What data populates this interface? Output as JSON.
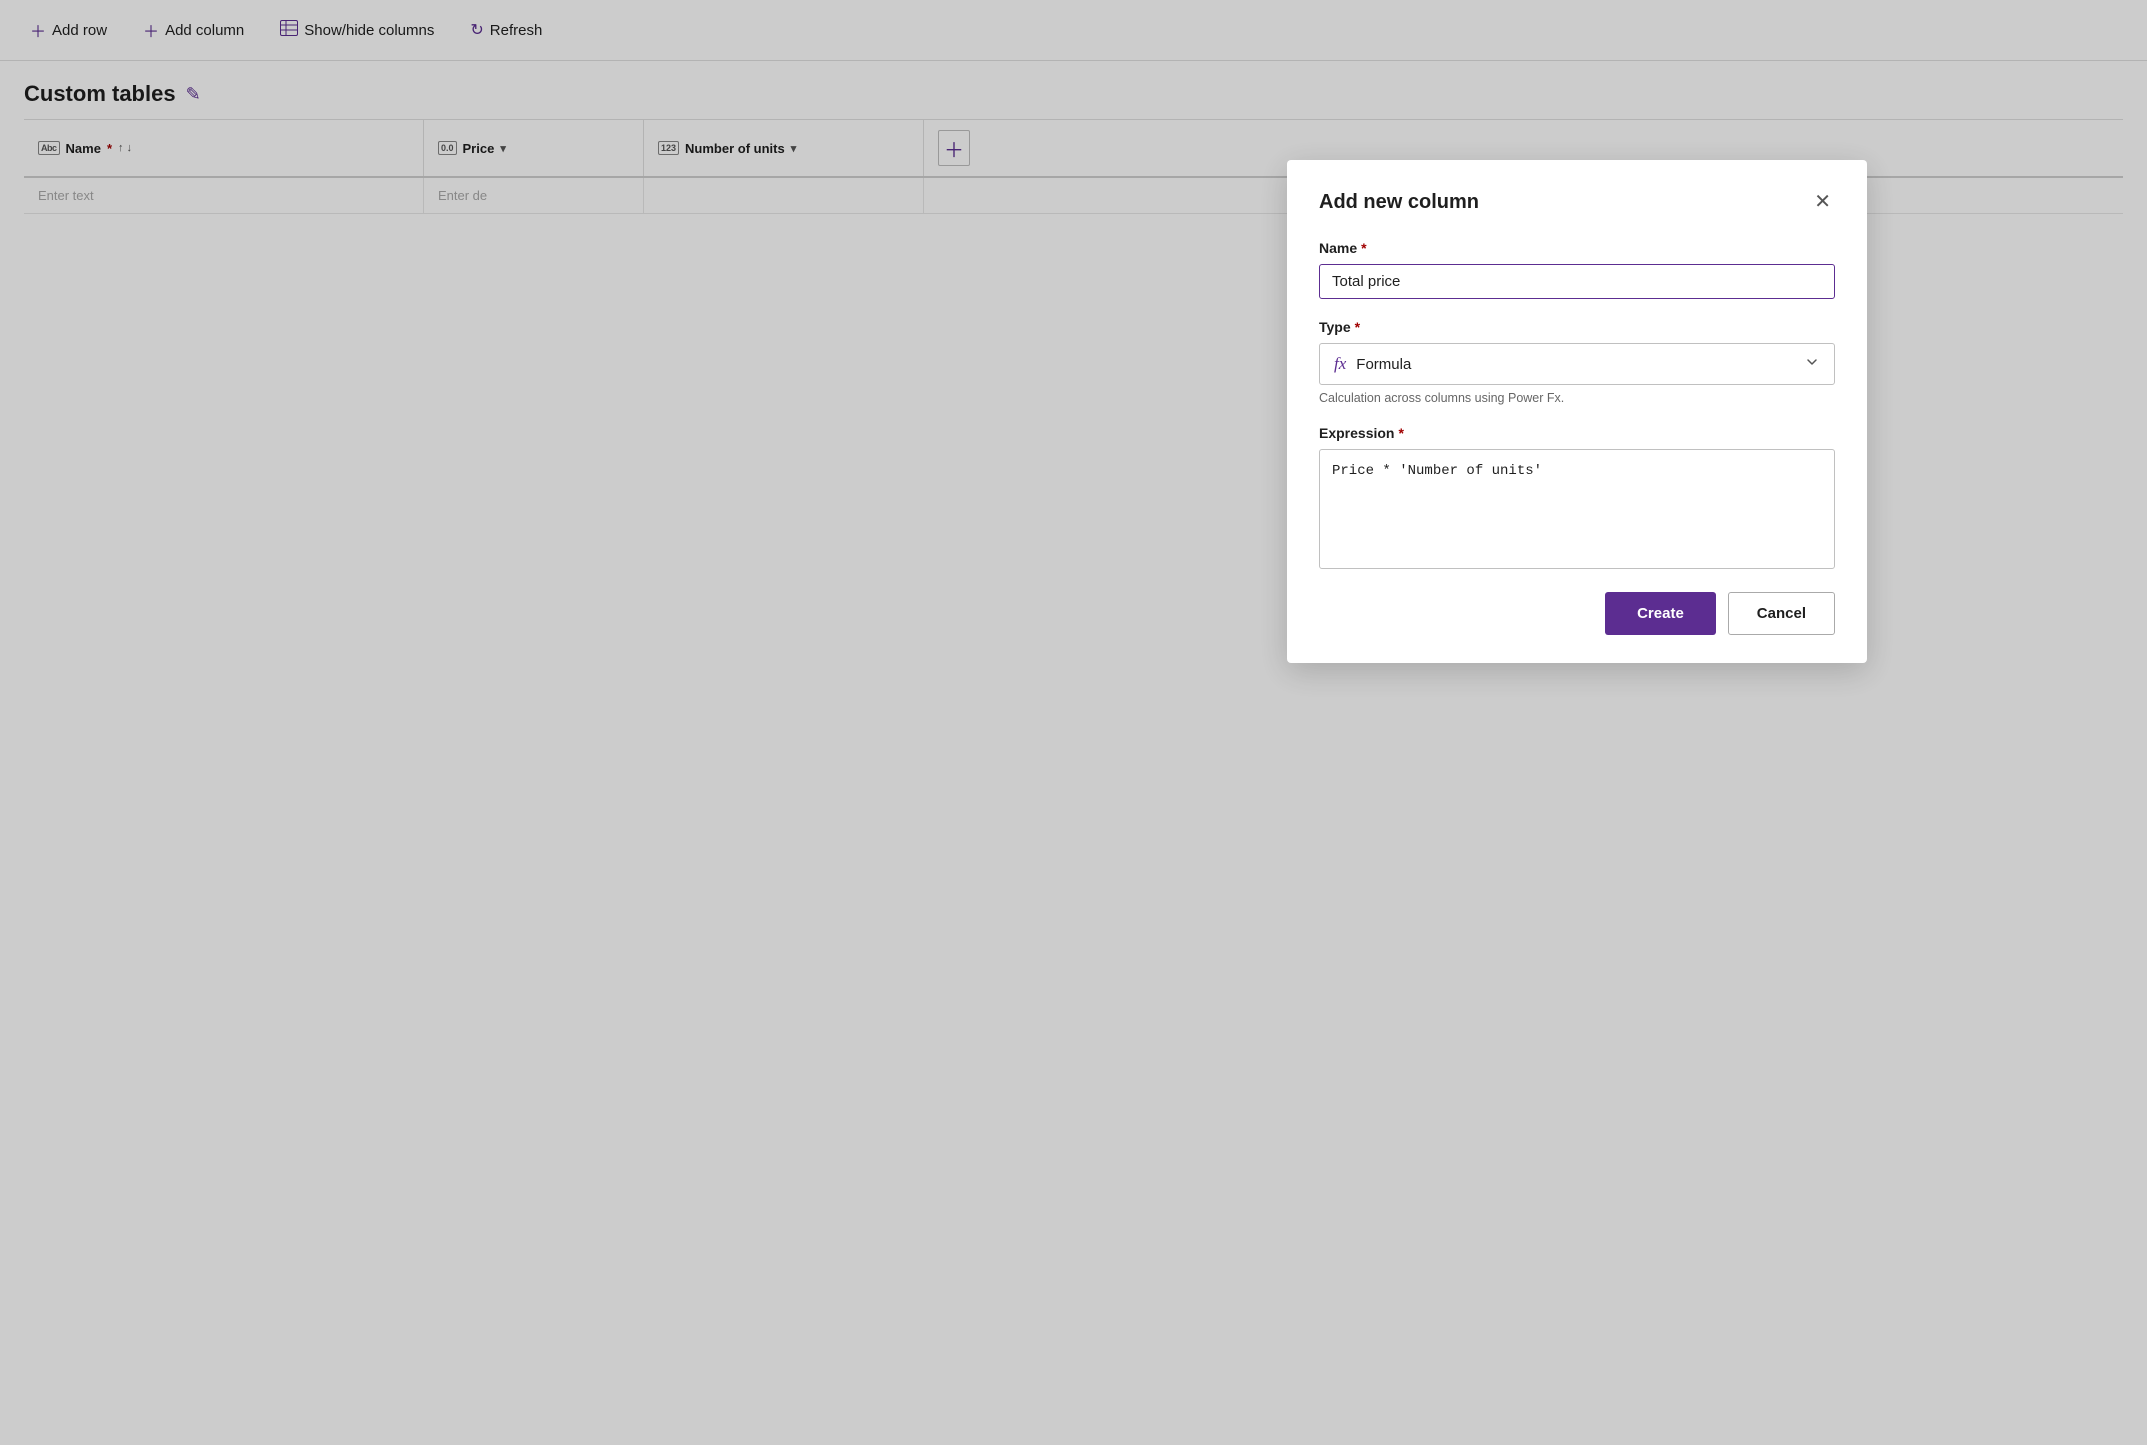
{
  "toolbar": {
    "add_row_label": "Add row",
    "add_column_label": "Add column",
    "show_hide_label": "Show/hide columns",
    "refresh_label": "Refresh"
  },
  "page": {
    "title": "Custom tables",
    "edit_icon": "✎"
  },
  "table": {
    "columns": [
      {
        "id": "name",
        "icon_type": "abc",
        "label": "Name",
        "required": true,
        "sortable": true
      },
      {
        "id": "price",
        "icon_type": "decimal",
        "label": "Price",
        "required": false,
        "sortable": false
      },
      {
        "id": "units",
        "icon_type": "123",
        "label": "Number of units",
        "required": false,
        "sortable": false
      }
    ],
    "rows": [
      {
        "name_placeholder": "Enter text",
        "price_placeholder": "Enter de",
        "units_placeholder": ""
      }
    ]
  },
  "panel": {
    "title": "Add new column",
    "name_label": "Name",
    "name_required": "*",
    "name_value": "Total price",
    "name_placeholder": "",
    "type_label": "Type",
    "type_required": "*",
    "type_value": "Formula",
    "fx_icon": "fx",
    "helper_text": "Calculation across columns using Power Fx.",
    "expression_label": "Expression",
    "expression_required": "*",
    "expression_value": "Price * 'Number of units'",
    "create_btn": "Create",
    "cancel_btn": "Cancel",
    "close_icon": "✕"
  },
  "colors": {
    "accent": "#5c2d91",
    "required": "#a00000"
  }
}
